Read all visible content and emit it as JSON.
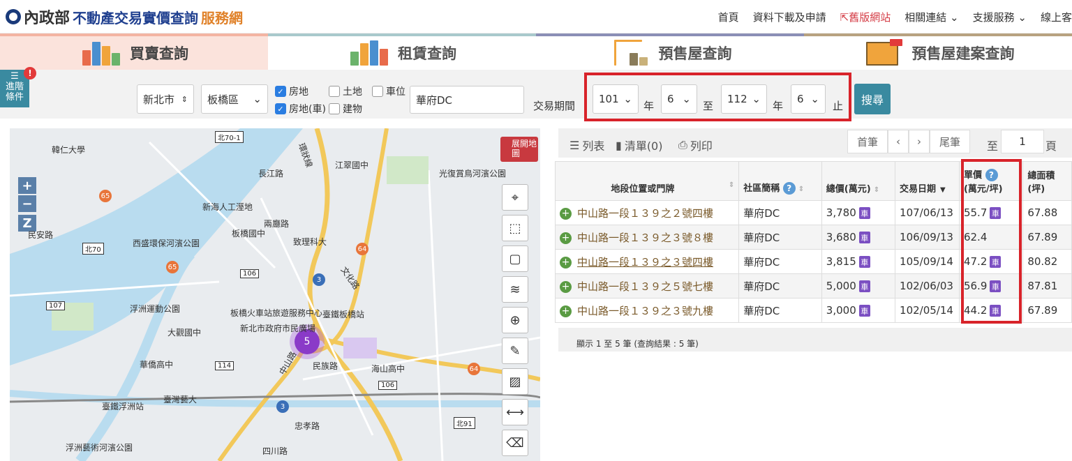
{
  "logo": {
    "ministry": "內政部",
    "blue": "不動產交易實價查詢",
    "orange": "服務網"
  },
  "topnav": [
    "首頁",
    "資料下載及申請",
    "舊版網站",
    "相關連結",
    "支援服務",
    "線上客"
  ],
  "tabs": [
    "買賣查詢",
    "租賃查詢",
    "預售屋查詢",
    "預售屋建案查詢"
  ],
  "adv_label": [
    "進階",
    "條件"
  ],
  "filter": {
    "city": "新北市",
    "district": "板橋區",
    "checks": [
      {
        "label": "房地",
        "checked": true
      },
      {
        "label": "土地",
        "checked": false
      },
      {
        "label": "車位",
        "checked": false
      },
      {
        "label": "房地(車)",
        "checked": true
      },
      {
        "label": "建物",
        "checked": false
      }
    ],
    "keyword": "華府DC",
    "period_label": "交易期間",
    "from_year": "101",
    "year_unit": "年",
    "from_month": "6",
    "to_label": "至",
    "to_year": "112",
    "to_month": "6",
    "end_label": "止",
    "search": "搜尋"
  },
  "map": {
    "expand": "展開地圖",
    "cluster_count": "5",
    "labels": [
      "韓仁大學",
      "新海人工溼地",
      "江翠國中",
      "光復賞鳥河濱公園",
      "板橋國中",
      "致理科大",
      "西盛環保河濱公園",
      "浮洲運動公園",
      "板橋火車站旅遊服務中心",
      "臺鐵板橋站",
      "新北市政府市民廣場",
      "大觀國中",
      "華僑高中",
      "海山高中",
      "臺灣藝大",
      "臺鐵浮洲站",
      "浮洲藝術河濱公園",
      "民安路",
      "環狀線",
      "文化路",
      "民族路",
      "中山路",
      "四川路",
      "忠孝路",
      "長江路",
      "兩廳路"
    ]
  },
  "toolbar": {
    "list": "列表",
    "clip": "清單(0)",
    "print": "列印",
    "first": "首筆",
    "last": "尾筆",
    "goto": "至",
    "page": "1",
    "page_unit": "頁"
  },
  "table": {
    "headers": [
      "地段位置或門牌",
      "社區簡稱",
      "總價(萬元)",
      "交易日期",
      "單價",
      "(萬元/坪)",
      "總面積",
      "(坪)"
    ],
    "rows": [
      {
        "addr": "中山路一段１３９之２號四樓",
        "community": "華府DC",
        "total": "3,780",
        "car": true,
        "date": "107/06/13",
        "unit": "55.7",
        "unit_car": true,
        "area": "67.88"
      },
      {
        "addr": "中山路一段１３９之３號８樓",
        "community": "華府DC",
        "total": "3,680",
        "car": true,
        "date": "106/09/13",
        "unit": "62.4",
        "unit_car": false,
        "area": "67.89"
      },
      {
        "addr": "中山路一段１３９之３號四樓",
        "community": "華府DC",
        "total": "3,815",
        "car": true,
        "date": "105/09/14",
        "unit": "47.2",
        "unit_car": true,
        "area": "80.82"
      },
      {
        "addr": "中山路一段１３９之５號七樓",
        "community": "華府DC",
        "total": "5,000",
        "car": true,
        "date": "102/06/03",
        "unit": "56.9",
        "unit_car": true,
        "area": "87.81"
      },
      {
        "addr": "中山路一段１３９之３號九樓",
        "community": "華府DC",
        "total": "3,000",
        "car": true,
        "date": "102/05/14",
        "unit": "44.2",
        "unit_car": true,
        "area": "67.89"
      }
    ],
    "car_glyph": "車",
    "summary": "顯示 1 至 5 筆 (查詢結果 : 5 筆)"
  },
  "colors": {
    "accent": "#3a8aa0",
    "highlight": "#d8232a",
    "cluster": "#8a3ac8"
  }
}
